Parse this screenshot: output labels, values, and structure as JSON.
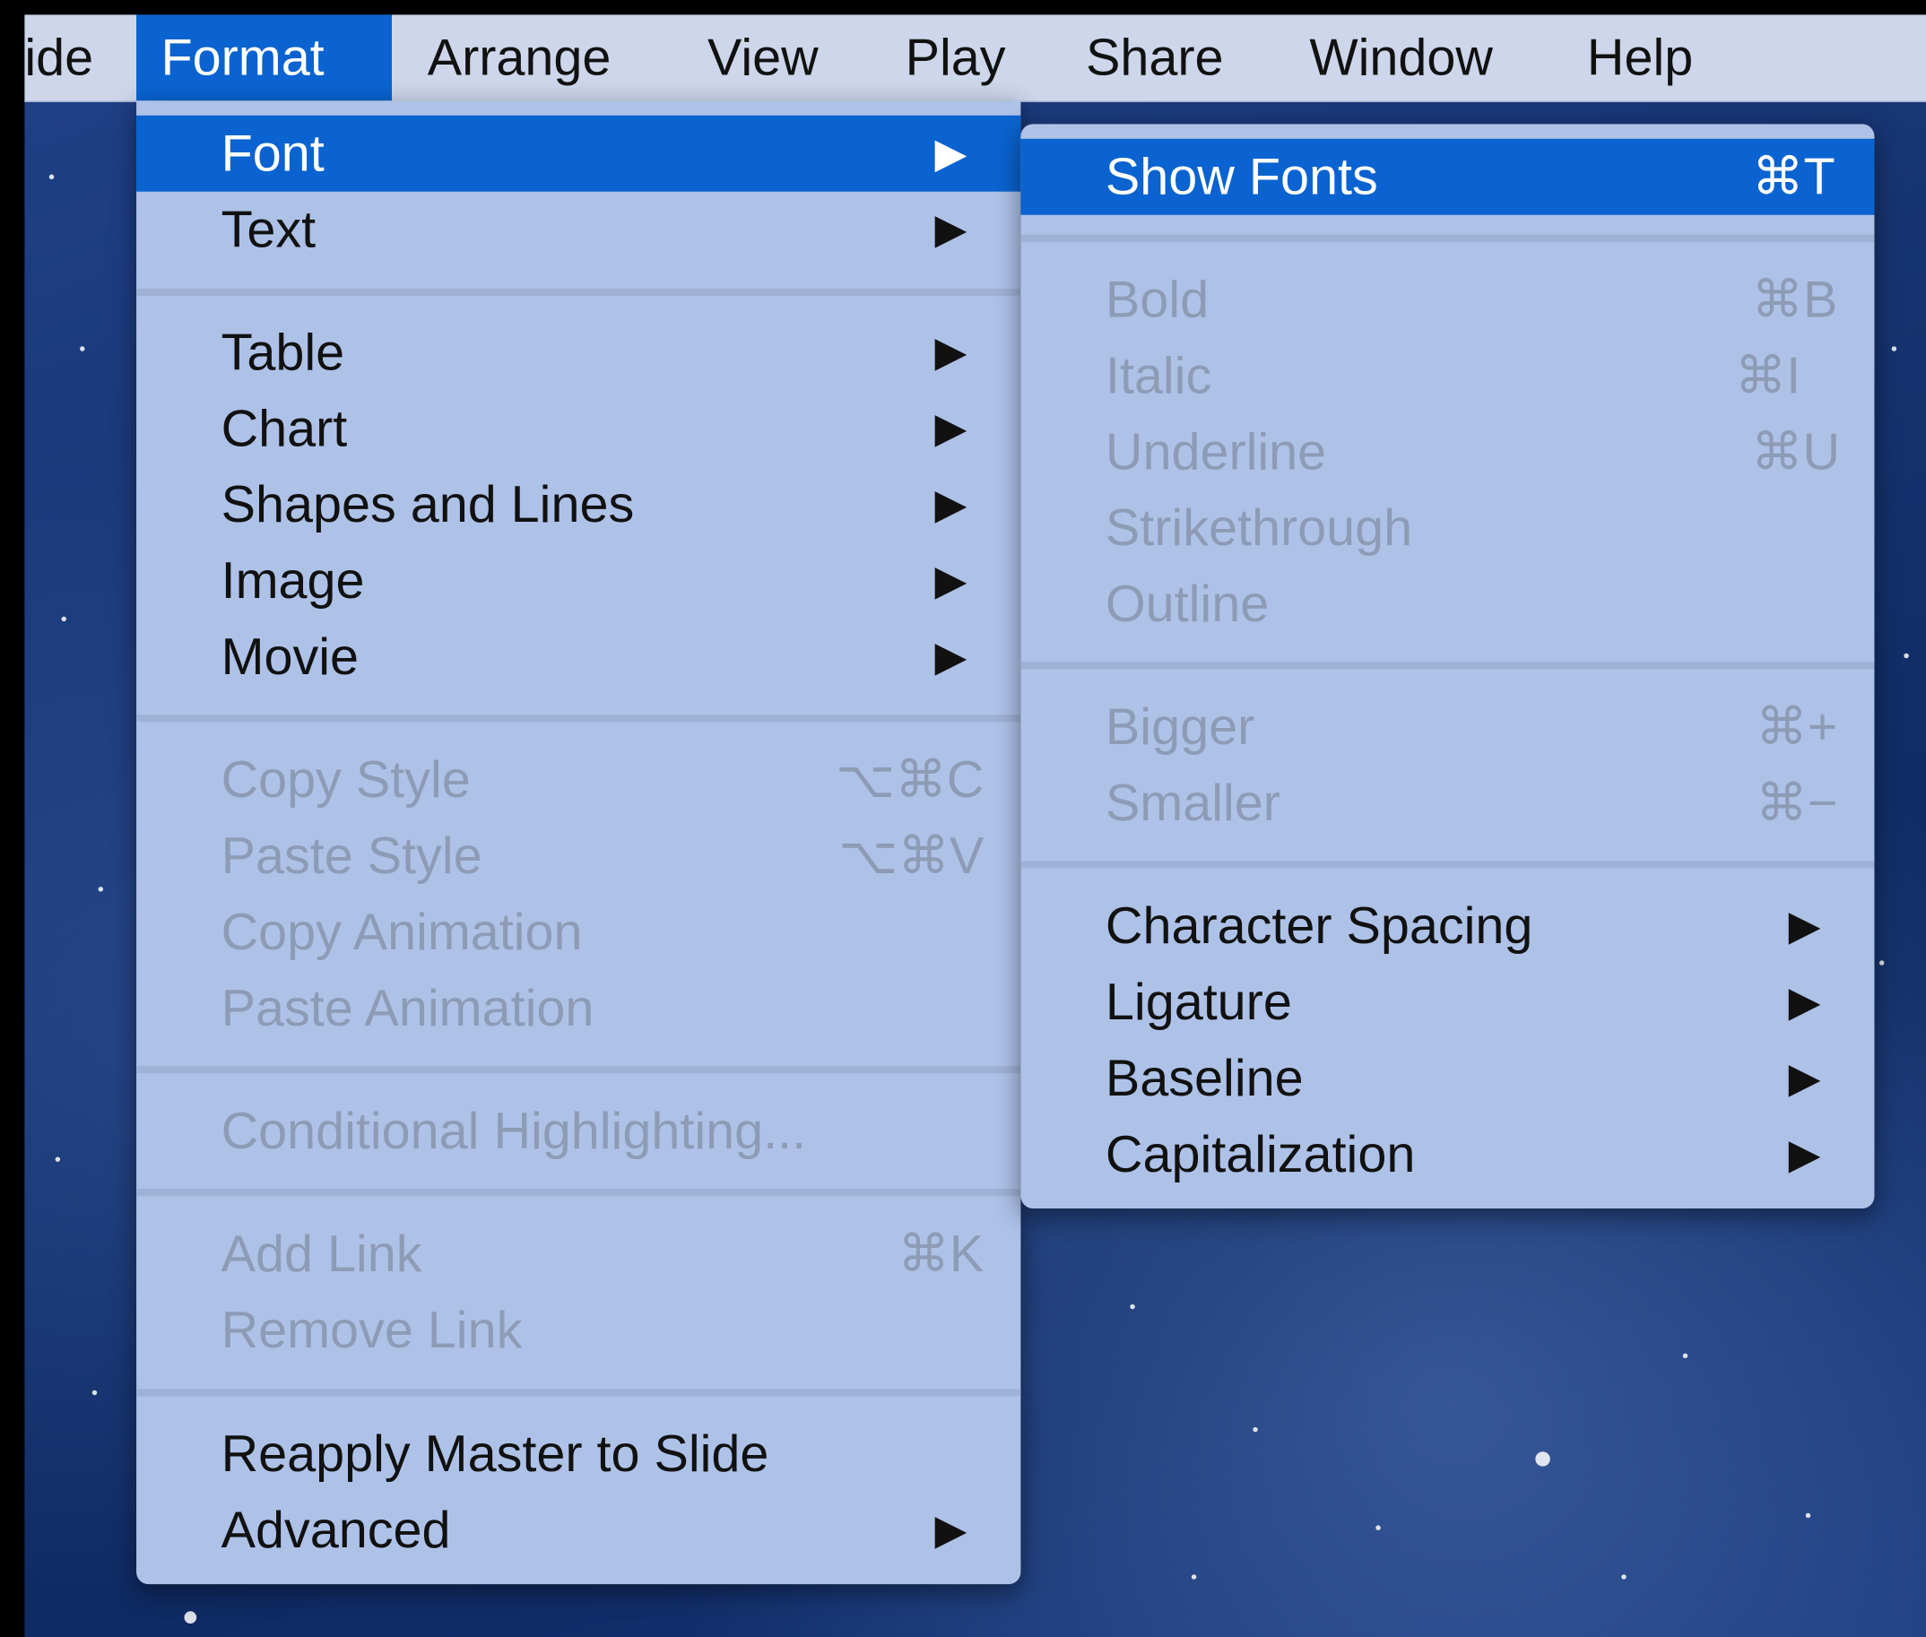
{
  "menubar": {
    "items": [
      "ide",
      "Format",
      "Arrange",
      "View",
      "Play",
      "Share",
      "Window",
      "Help"
    ],
    "active": "Format"
  },
  "format_menu": {
    "font": "Font",
    "text": "Text",
    "table": "Table",
    "chart": "Chart",
    "shapes_and_lines": "Shapes and Lines",
    "image": "Image",
    "movie": "Movie",
    "copy_style": "Copy Style",
    "copy_style_shortcut": "⌥⌘C",
    "paste_style": "Paste Style",
    "paste_style_shortcut": "⌥⌘V",
    "copy_animation": "Copy Animation",
    "paste_animation": "Paste Animation",
    "conditional_highlighting": "Conditional Highlighting...",
    "add_link": "Add Link",
    "add_link_shortcut": "⌘K",
    "remove_link": "Remove Link",
    "reapply_master": "Reapply Master to Slide",
    "advanced": "Advanced"
  },
  "font_submenu": {
    "show_fonts": "Show Fonts",
    "show_fonts_shortcut": "⌘T",
    "bold": "Bold",
    "bold_shortcut": "⌘B",
    "italic": "Italic",
    "italic_shortcut": "⌘I",
    "underline": "Underline",
    "underline_shortcut": "⌘U",
    "strikethrough": "Strikethrough",
    "outline": "Outline",
    "bigger": "Bigger",
    "bigger_shortcut": "⌘+",
    "smaller": "Smaller",
    "smaller_shortcut": "⌘−",
    "character_spacing": "Character Spacing",
    "ligature": "Ligature",
    "baseline": "Baseline",
    "capitalization": "Capitalization"
  },
  "submenu_arrow": "▶",
  "colors": {
    "highlight": "#0a63d0",
    "menu_bg": "#aec2e8",
    "menubar_bg": "#cdd6ea",
    "disabled_text": "#8e9bb5",
    "desktop": "#17377a"
  }
}
